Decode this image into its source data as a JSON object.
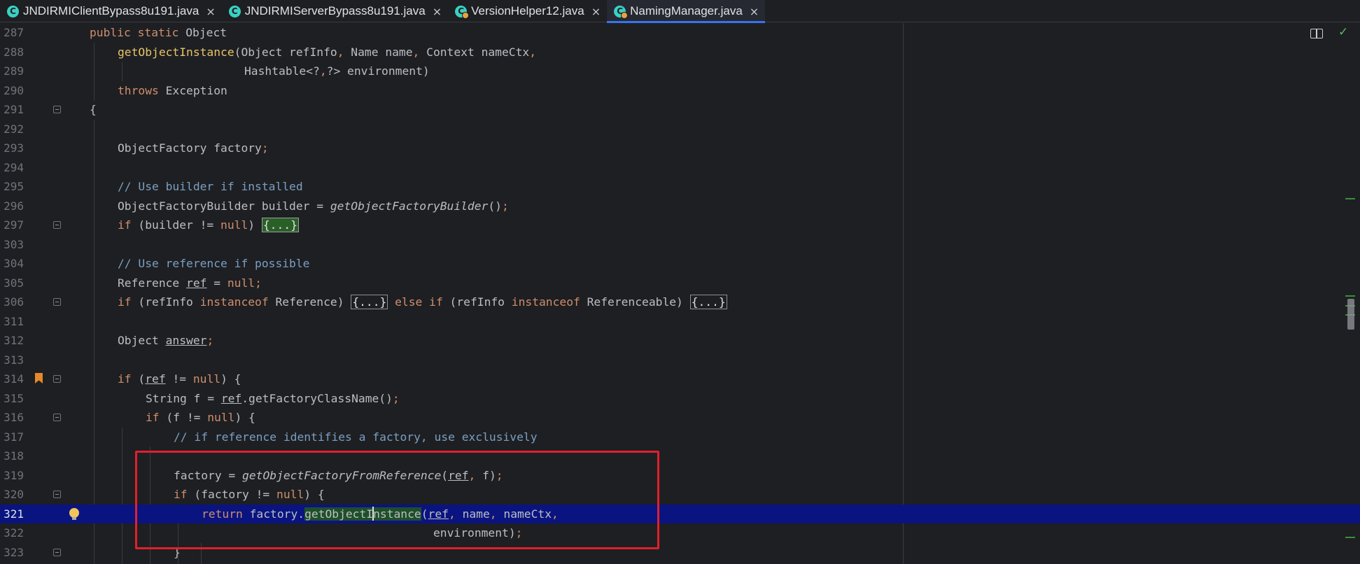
{
  "tabs": [
    {
      "label": "JNDIRMIClientBypass8u191.java",
      "close": "×",
      "active": false,
      "icon": "C",
      "hotswap": false
    },
    {
      "label": "JNDIRMIServerBypass8u191.java",
      "close": "×",
      "active": false,
      "icon": "C",
      "hotswap": false
    },
    {
      "label": "VersionHelper12.java",
      "close": "×",
      "active": false,
      "icon": "C",
      "hotswap": true
    },
    {
      "label": "NamingManager.java",
      "close": "×",
      "active": true,
      "icon": "C",
      "hotswap": true
    }
  ],
  "editor": {
    "status_icons": [
      "reader-mode-icon",
      "check-icon"
    ],
    "colors": {
      "highlight_line": "#0a1480",
      "annotation_box": "#e0202b",
      "keyword": "#cf8e6d",
      "method": "#e8c46a",
      "comment": "#7a9fc4"
    },
    "lines": [
      {
        "n": "287"
      },
      {
        "n": "288"
      },
      {
        "n": "289"
      },
      {
        "n": "290"
      },
      {
        "n": "291"
      },
      {
        "n": "292"
      },
      {
        "n": "293"
      },
      {
        "n": "294"
      },
      {
        "n": "295"
      },
      {
        "n": "296"
      },
      {
        "n": "297"
      },
      {
        "n": "303"
      },
      {
        "n": "304"
      },
      {
        "n": "305"
      },
      {
        "n": "306"
      },
      {
        "n": "311"
      },
      {
        "n": "312"
      },
      {
        "n": "313"
      },
      {
        "n": "314"
      },
      {
        "n": "315"
      },
      {
        "n": "316"
      },
      {
        "n": "317"
      },
      {
        "n": "318"
      },
      {
        "n": "319"
      },
      {
        "n": "320"
      },
      {
        "n": "321"
      },
      {
        "n": "322"
      },
      {
        "n": "323"
      }
    ],
    "code": {
      "l287": {
        "kw1": "public static",
        "t1": " Object"
      },
      "l288": {
        "fn": "getObjectInstance",
        "t1": "(Object refInfo",
        "p1": ",",
        "t2": " Name name",
        "p2": ",",
        "t3": " Context nameCtx",
        "p3": ","
      },
      "l289": {
        "t1": "Hashtable<?",
        "p1": ",",
        "t2": "?> environment)"
      },
      "l290": {
        "kw": "throws",
        "t1": " Exception"
      },
      "l291": {
        "t1": "{"
      },
      "l293": {
        "t1": "ObjectFactory factory",
        "p1": ";"
      },
      "l295": {
        "cm": "// Use builder if installed"
      },
      "l296": {
        "t1": "ObjectFactoryBuilder builder = ",
        "fn": "getObjectFactoryBuilder",
        "t2": "()",
        "p1": ";"
      },
      "l297": {
        "kw": "if",
        "t1": " (builder != ",
        "kw2": "null",
        "t2": ") ",
        "fold": "{...}"
      },
      "l304": {
        "cm": "// Use reference if possible"
      },
      "l305": {
        "t1": "Reference ",
        "v1": "ref",
        "t2": " = ",
        "kw": "null",
        "p1": ";"
      },
      "l306": {
        "kw": "if",
        "t1": " (refInfo ",
        "kw2": "instanceof",
        "t2": " Reference) ",
        "fold1": "{...}",
        "kw3": " else if",
        "t3": " (refInfo ",
        "kw4": "instanceof",
        "t4": " Referenceable) ",
        "fold2": "{...}"
      },
      "l312": {
        "t1": "Object ",
        "v1": "answer",
        "p1": ";"
      },
      "l314": {
        "kw": "if",
        "t1": " (",
        "v1": "ref",
        "t2": " != ",
        "kw2": "null",
        "t3": ") {"
      },
      "l315": {
        "t1": "String f = ",
        "v1": "ref",
        "t2": ".getFactoryClassName()",
        "p1": ";"
      },
      "l316": {
        "kw": "if",
        "t1": " (f != ",
        "kw2": "null",
        "t2": ") {"
      },
      "l317": {
        "cm": "// if reference identifies a factory, use exclusively"
      },
      "l319": {
        "t1": "factory = ",
        "fn": "getObjectFactoryFromReference",
        "t2": "(",
        "v1": "ref",
        "p1": ",",
        "t3": " f)",
        "p2": ";"
      },
      "l320": {
        "kw": "if",
        "t1": " (factory != ",
        "kw2": "null",
        "t2": ") {"
      },
      "l321": {
        "kw": "return",
        "t1": " factory.",
        "m1": "getObjectI",
        "m2": "nstance",
        "t2": "(",
        "v1": "ref",
        "p1": ",",
        "t3": " name",
        "p2": ",",
        "t4": " nameCtx",
        "p3": ","
      },
      "l322": {
        "t1": "environment)",
        "p1": ";"
      },
      "l323": {
        "t1": "}"
      }
    }
  }
}
